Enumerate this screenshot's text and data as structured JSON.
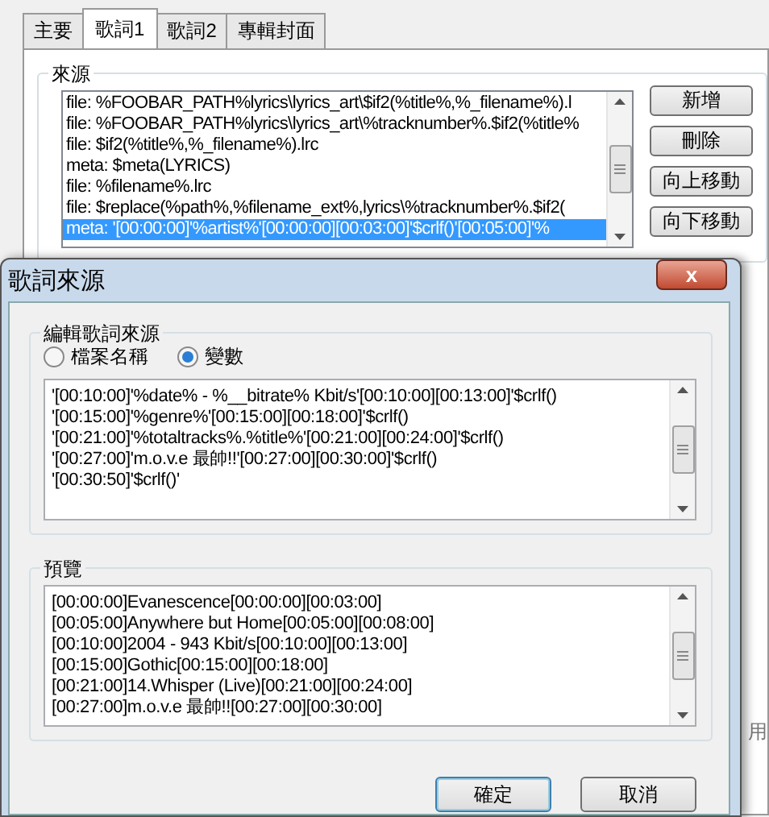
{
  "tabs": [
    {
      "label": "主要",
      "selected": false
    },
    {
      "label": "歌詞1",
      "selected": true
    },
    {
      "label": "歌詞2",
      "selected": false
    },
    {
      "label": "專輯封面",
      "selected": false
    }
  ],
  "sources": {
    "title": "來源",
    "items": [
      {
        "text": "file: %FOOBAR_PATH%lyrics\\lyrics_art\\$if2(%title%,%_filename%).l",
        "selected": false
      },
      {
        "text": "file: %FOOBAR_PATH%lyrics\\lyrics_art\\%tracknumber%.$if2(%title%",
        "selected": false
      },
      {
        "text": "file: $if2(%title%,%_filename%).lrc",
        "selected": false
      },
      {
        "text": "meta: $meta(LYRICS)",
        "selected": false
      },
      {
        "text": "file: %filename%.lrc",
        "selected": false
      },
      {
        "text": "file: $replace(%path%,%filename_ext%,lyrics\\%tracknumber%.$if2(",
        "selected": false
      },
      {
        "text": "meta: '[00:00:00]'%artist%'[00:00:00][00:03:00]'$crlf()'[00:05:00]'%",
        "selected": true
      }
    ],
    "buttons": [
      "新增",
      "刪除",
      "向上移動",
      "向下移動"
    ]
  },
  "background_button_fragment": "用",
  "dialog": {
    "title": "歌詞來源",
    "close": "x",
    "edit_group": {
      "title": "編輯歌詞來源",
      "radios": [
        {
          "label": "檔案名稱",
          "selected": false
        },
        {
          "label": "變數",
          "selected": true
        }
      ],
      "lines": [
        "'[00:10:00]'%date% - %__bitrate% Kbit/s'[00:10:00][00:13:00]'$crlf()",
        "'[00:15:00]'%genre%'[00:15:00][00:18:00]'$crlf()",
        "'[00:21:00]'%totaltracks%.%title%'[00:21:00][00:24:00]'$crlf()",
        "'[00:27:00]'m.o.v.e 最帥!!'[00:27:00][00:30:00]'$crlf()",
        "'[00:30:50]'$crlf()'"
      ]
    },
    "preview": {
      "title": "預覽",
      "lines": [
        "[00:00:00]Evanescence[00:00:00][00:03:00]",
        "[00:05:00]Anywhere but Home[00:05:00][00:08:00]",
        "[00:10:00]2004 - 943 Kbit/s[00:10:00][00:13:00]",
        "[00:15:00]Gothic[00:15:00][00:18:00]",
        "[00:21:00]14.Whisper (Live)[00:21:00][00:24:00]",
        "[00:27:00]m.o.v.e 最帥!![00:27:00][00:30:00]"
      ]
    },
    "buttons": [
      {
        "label": "確定",
        "default": true
      },
      {
        "label": "取消",
        "default": false
      }
    ]
  }
}
